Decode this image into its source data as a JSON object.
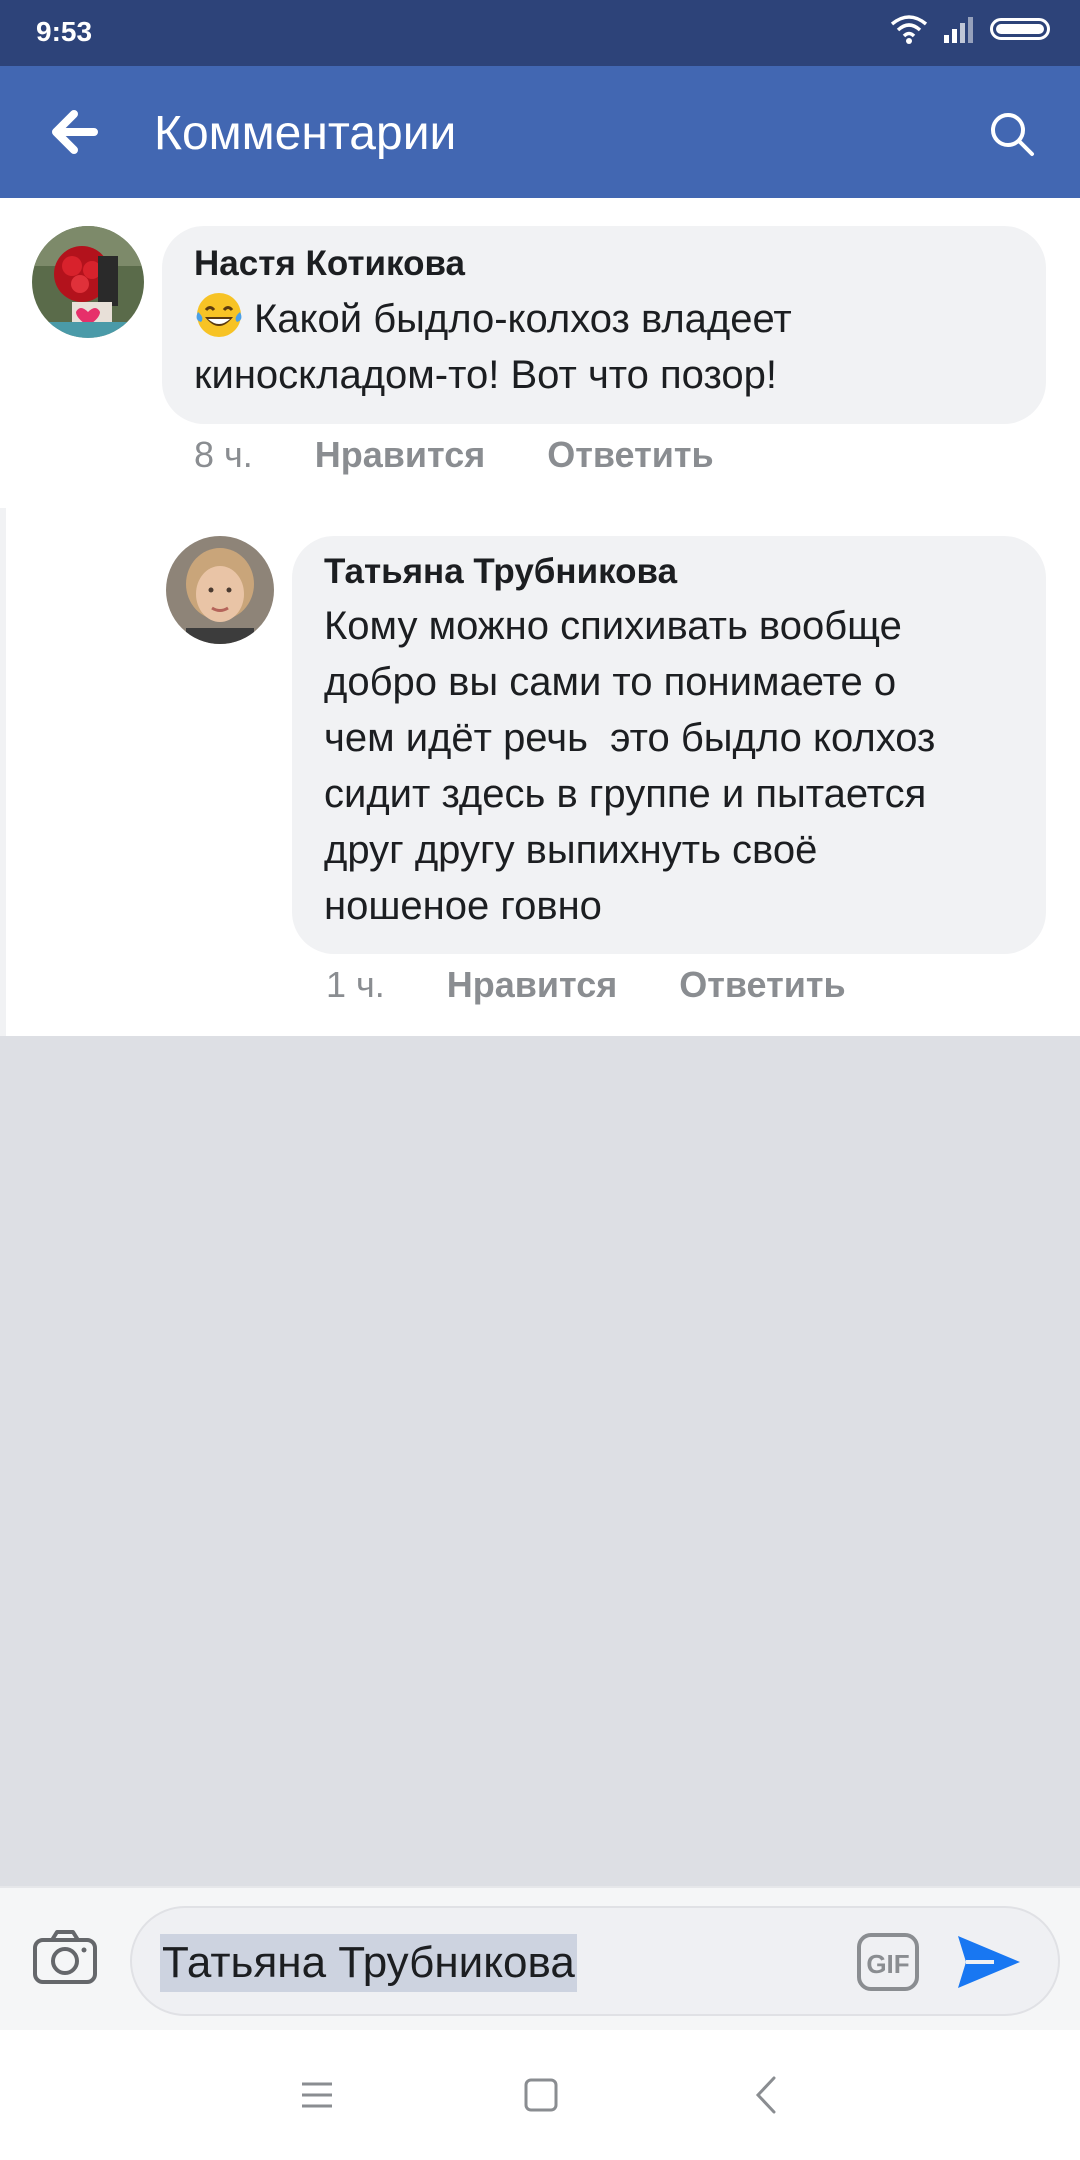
{
  "status_bar": {
    "time": "9:53"
  },
  "header": {
    "title": "Комментарии",
    "back_icon": "arrow-left-icon",
    "search_icon": "search-icon"
  },
  "comments": [
    {
      "author": "Настя Котикова",
      "emoji": "laughing-tears-emoji",
      "text": "Какой быдло-колхоз владеет киноскладом-то! Вот что позор!",
      "time": "8 ч.",
      "like_label": "Нравится",
      "reply_label": "Ответить"
    },
    {
      "author": "Татьяна Трубникова",
      "text_lines": [
        "Кому можно спихивать вообще",
        "добро вы сами то понимаете о",
        "чем идёт речь  это быдло колхоз",
        "сидит здесь в группе и пытается",
        "друг другу выпихнуть своё",
        "ношеное говно"
      ],
      "time": "1 ч.",
      "like_label": "Нравится",
      "reply_label": "Ответить"
    }
  ],
  "composer": {
    "value": "Татьяна Трубникова",
    "camera_icon": "camera-icon",
    "gif_label": "GIF",
    "send_icon": "send-icon"
  },
  "colors": {
    "status_bar": "#2d4379",
    "app_bar": "#4267b2",
    "accent": "#1877f2",
    "bubble": "#f1f2f4"
  }
}
